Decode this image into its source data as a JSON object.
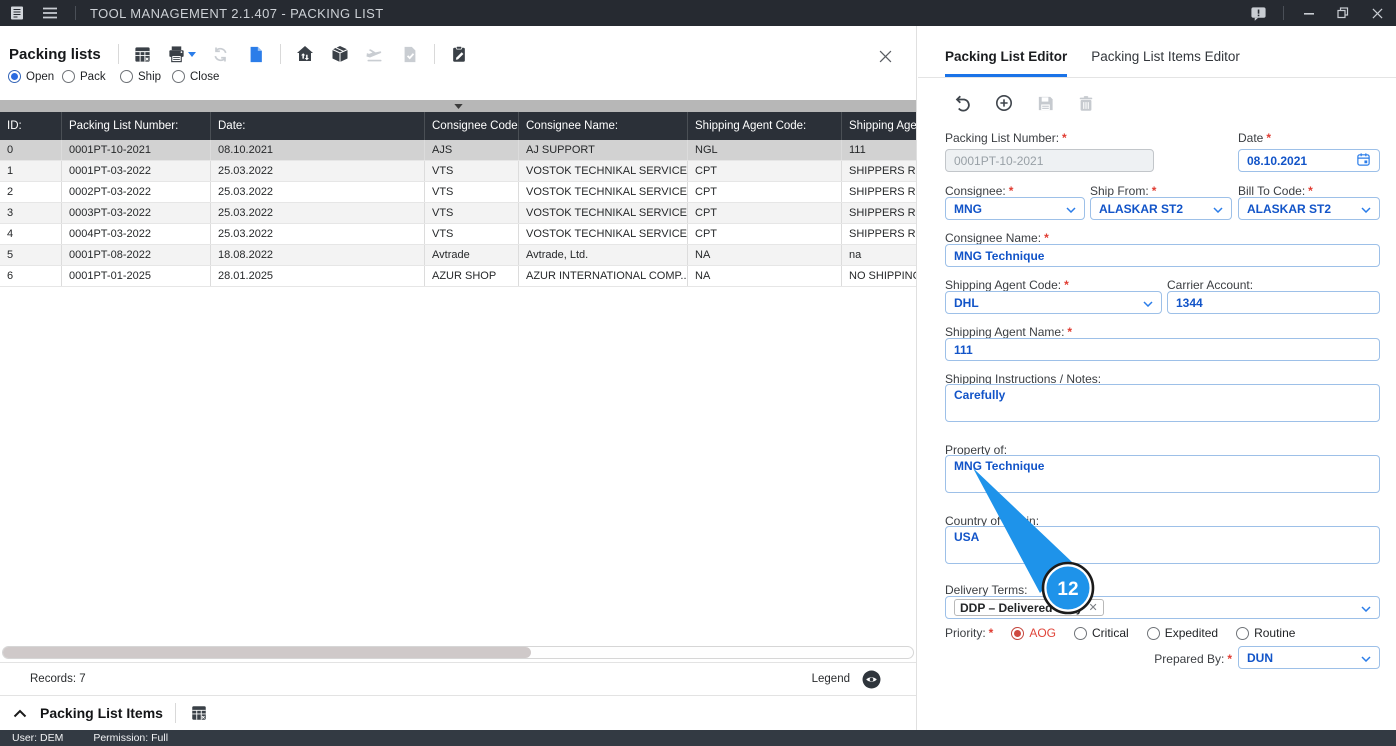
{
  "window": {
    "title": "TOOL MANAGEMENT 2.1.407 - PACKING LIST"
  },
  "statusbar": {
    "user": "User: DEM",
    "permission": "Permission: Full"
  },
  "marks": {
    "required": "*",
    "chip_close": "✕"
  },
  "left": {
    "title": "Packing lists",
    "filters": [
      {
        "label": "Open"
      },
      {
        "label": "Pack"
      },
      {
        "label": "Ship"
      },
      {
        "label": "Close"
      }
    ],
    "table": {
      "headers": [
        "ID:",
        "Packing List Number:",
        "Date:",
        "Consignee Code:",
        "Consignee Name:",
        "Shipping Agent Code:",
        "Shipping Age"
      ],
      "rows": [
        [
          "0",
          "0001PT-10-2021",
          "08.10.2021",
          "AJS",
          "AJ SUPPORT",
          "NGL",
          "111"
        ],
        [
          "1",
          "0001PT-03-2022",
          "25.03.2022",
          "VTS",
          "VOSTOK TECHNIKAL SERVICES",
          "CPT",
          "SHIPPERS RESPO"
        ],
        [
          "2",
          "0002PT-03-2022",
          "25.03.2022",
          "VTS",
          "VOSTOK TECHNIKAL SERVICES",
          "CPT",
          "SHIPPERS RESPO"
        ],
        [
          "3",
          "0003PT-03-2022",
          "25.03.2022",
          "VTS",
          "VOSTOK TECHNIKAL SERVICES",
          "CPT",
          "SHIPPERS RESPO"
        ],
        [
          "4",
          "0004PT-03-2022",
          "25.03.2022",
          "VTS",
          "VOSTOK TECHNIKAL SERVICES",
          "CPT",
          "SHIPPERS RESPO"
        ],
        [
          "5",
          "0001PT-08-2022",
          "18.08.2022",
          "Avtrade",
          "Avtrade, Ltd.",
          "NA",
          "na"
        ],
        [
          "6",
          "0001PT-01-2025",
          "28.01.2025",
          "AZUR SHOP",
          "AZUR INTERNATIONAL COMP...",
          "NA",
          "NO SHIPPING A"
        ]
      ]
    },
    "records": "Records: 7",
    "legend": "Legend",
    "items_title": "Packing List Items"
  },
  "editor": {
    "tabs": [
      {
        "label": "Packing List Editor"
      },
      {
        "label": "Packing List Items Editor"
      }
    ],
    "fields": {
      "packing_list_number": {
        "label": "Packing List Number:",
        "value": "0001PT-10-2021"
      },
      "date": {
        "label": "Date",
        "value": "08.10.2021"
      },
      "consignee": {
        "label": "Consignee:",
        "value": "MNG"
      },
      "ship_from": {
        "label": "Ship From:",
        "value": "ALASKAR ST2"
      },
      "bill_to": {
        "label": "Bill To Code:",
        "value": "ALASKAR ST2"
      },
      "consignee_name": {
        "label": "Consignee Name:",
        "value": "MNG Technique"
      },
      "shipping_agent_code": {
        "label": "Shipping Agent Code:",
        "value": "DHL"
      },
      "carrier_account": {
        "label": "Carrier Account:",
        "value": "1344"
      },
      "shipping_agent_name": {
        "label": "Shipping Agent Name:",
        "value": "111"
      },
      "shipping_instructions": {
        "label": "Shipping Instructions / Notes:",
        "value": "Carefully"
      },
      "property_of": {
        "label": "Property of:",
        "value": "MNG Technique"
      },
      "country_of_origin": {
        "label": "Country of Origin:",
        "value": "USA"
      },
      "delivery_terms": {
        "label": "Delivery Terms:",
        "chip": "DDP – Delivered Duty"
      },
      "priority": {
        "label": "Priority:",
        "options": [
          "AOG",
          "Critical",
          "Expedited",
          "Routine"
        ],
        "selected": "AOG"
      },
      "prepared_by": {
        "label": "Prepared By:",
        "value": "DUN"
      }
    },
    "callout": {
      "step": "12"
    }
  },
  "colors": {
    "accent": "#1a73e8",
    "value_text": "#1254c8",
    "callout_blue": "#1e93ea",
    "required_red": "#e03c32",
    "titlebar": "#262a31",
    "statusbar": "#333a43",
    "grid_header": "#2b3038",
    "selected_row": "#d2d2d2"
  }
}
